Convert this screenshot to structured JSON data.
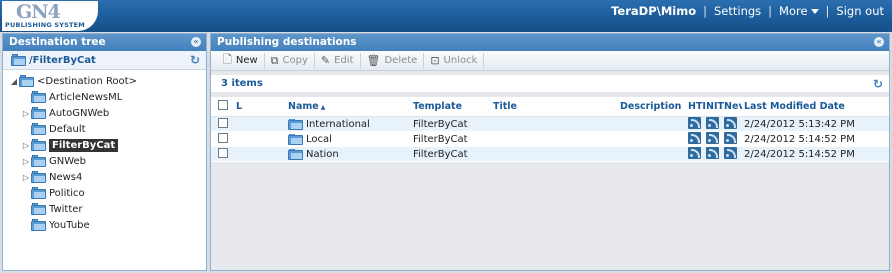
{
  "header": {
    "logo_text": "GN4",
    "logo_sub": "PUBLISHING SYSTEM",
    "user": "TeraDP\\Mimo",
    "settings_label": "Settings",
    "more_label": "More",
    "signout_label": "Sign out"
  },
  "left_panel": {
    "title": "Destination tree",
    "current_path": "/FilterByCat",
    "tree": {
      "root_label": "<Destination Root>",
      "items": [
        {
          "label": "ArticleNewsML",
          "expandable": false
        },
        {
          "label": "AutoGNWeb",
          "expandable": true
        },
        {
          "label": "Default",
          "expandable": false
        },
        {
          "label": "FilterByCat",
          "expandable": true,
          "selected": true
        },
        {
          "label": "GNWeb",
          "expandable": true
        },
        {
          "label": "News4",
          "expandable": true
        },
        {
          "label": "Politico",
          "expandable": false
        },
        {
          "label": "Twitter",
          "expandable": false
        },
        {
          "label": "YouTube",
          "expandable": false
        }
      ]
    }
  },
  "right_panel": {
    "title": "Publishing destinations",
    "toolbar": {
      "new_label": "New",
      "copy_label": "Copy",
      "edit_label": "Edit",
      "delete_label": "Delete",
      "unlock_label": "Unlock"
    },
    "count_label": "3 items",
    "columns": {
      "l": "L",
      "name": "Name",
      "template": "Template",
      "title": "Title",
      "description": "Description",
      "h": "HTI",
      "n": "NIT",
      "nw": "Nev",
      "date": "Last Modified Date"
    },
    "rows": [
      {
        "name": "International",
        "template": "FilterByCat",
        "date": "2/24/2012 5:13:42 PM"
      },
      {
        "name": "Local",
        "template": "FilterByCat",
        "date": "2/24/2012 5:14:52 PM"
      },
      {
        "name": "Nation",
        "template": "FilterByCat",
        "date": "2/24/2012 5:14:52 PM"
      }
    ]
  }
}
